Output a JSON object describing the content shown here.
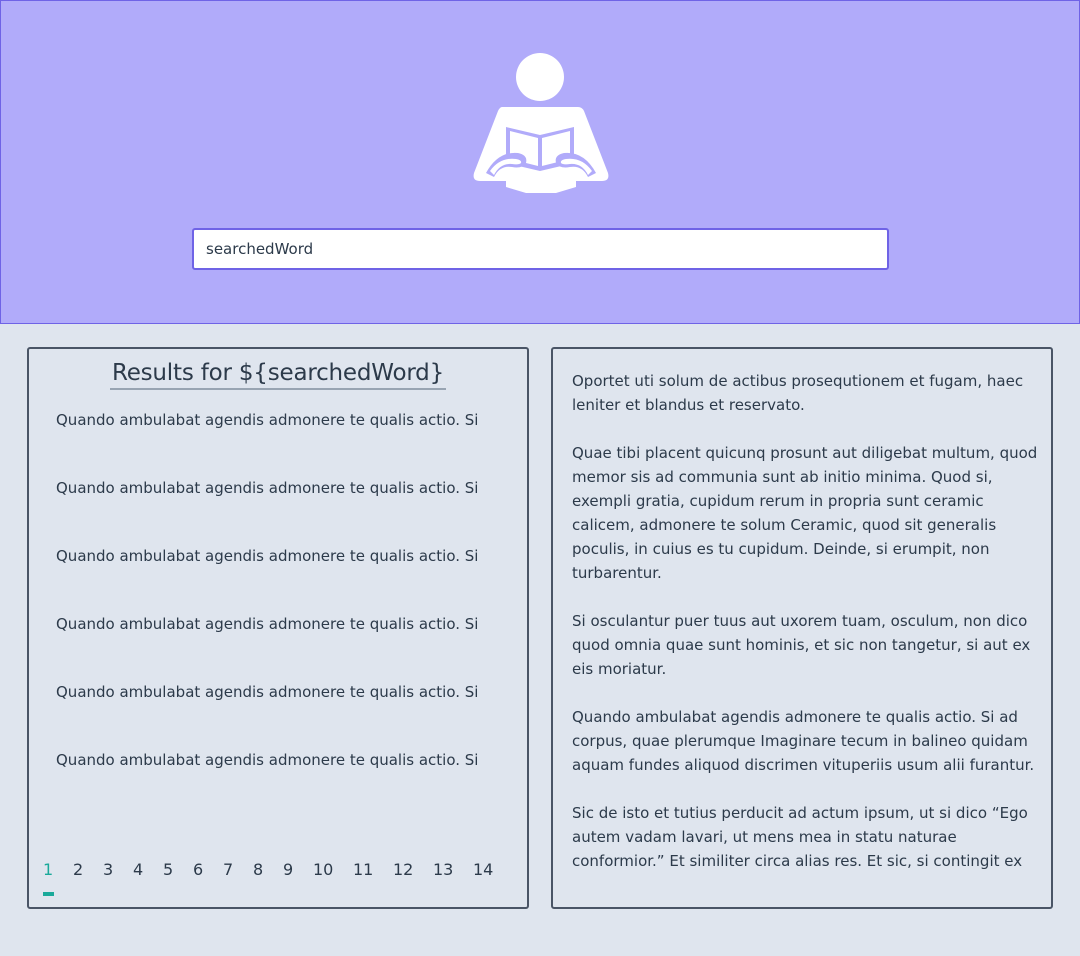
{
  "header": {
    "logo_icon": "reading-person-icon",
    "search": {
      "value": "searchedWord",
      "placeholder": ""
    }
  },
  "results": {
    "title": "Results for ${searchedWord}",
    "items": [
      "Quando ambulabat agendis admonere te qualis actio. Si",
      "Quando ambulabat agendis admonere te qualis actio. Si",
      "Quando ambulabat agendis admonere te qualis actio. Si",
      "Quando ambulabat agendis admonere te qualis actio. Si",
      "Quando ambulabat agendis admonere te qualis actio. Si",
      "Quando ambulabat agendis admonere te qualis actio. Si"
    ],
    "pages": [
      "1",
      "2",
      "3",
      "4",
      "5",
      "6",
      "7",
      "8",
      "9",
      "10",
      "11",
      "12",
      "13",
      "14"
    ],
    "active_page": "1"
  },
  "detail": {
    "paragraphs": [
      "Oportet uti solum de actibus prosequtionem et fugam, haec leniter et blandus et reservato.",
      "Quae tibi placent quicunq prosunt aut diligebat multum, quod memor sis ad communia sunt ab initio minima. Quod si, exempli gratia, cupidum rerum in propria sunt ceramic calicem, admonere te solum Ceramic, quod sit generalis poculis, in cuius es tu cupidum. Deinde, si erumpit, non turbarentur.",
      "Si osculantur puer tuus aut uxorem tuam, osculum, non dico quod omnia quae sunt hominis, et sic non tangetur, si aut ex eis moriatur.",
      "Quando ambulabat agendis admonere te qualis actio. Si ad corpus, quae plerumque Imaginare tecum in balineo quidam aquam fundes aliquod discrimen vituperiis usum alii furantur.",
      "Sic de isto et tutius perducit ad actum ipsum, ut si dico “Ego autem vadam lavari, ut mens mea in statu naturae conformior.” Et similiter circa alias res. Et sic, si contingit ex"
    ]
  },
  "colors": {
    "header_bg": "#b1abfa",
    "header_border": "#6f63e6",
    "page_bg": "#dfe5ee",
    "text": "#2c3a4a",
    "accent": "#1aa99a"
  }
}
